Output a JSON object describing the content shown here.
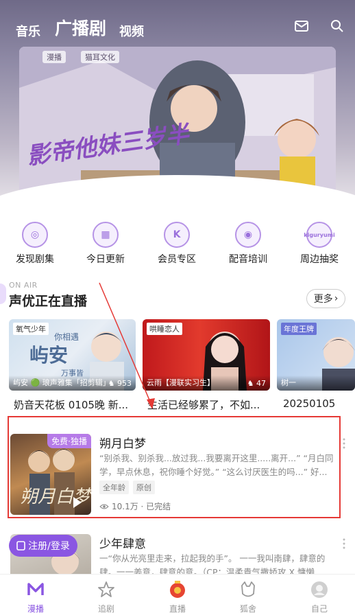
{
  "nav": {
    "tabs": [
      {
        "label": "音乐"
      },
      {
        "label": "广播剧"
      },
      {
        "label": "视频"
      }
    ],
    "icons": [
      "mail-icon",
      "search-icon"
    ]
  },
  "banner": {
    "logos": [
      "漫播",
      "猫耳文化"
    ],
    "title": "影帝他妹三岁半"
  },
  "categories": [
    {
      "label": "发现剧集",
      "icon": "discover-icon"
    },
    {
      "label": "今日更新",
      "icon": "calendar-icon"
    },
    {
      "label": "会员专区",
      "icon": "vip-icon"
    },
    {
      "label": "配音培训",
      "icon": "mic-icon"
    },
    {
      "label": "周边抽奖",
      "icon": "kiguryumi-icon",
      "icon_text": "kiguryumi"
    }
  ],
  "live": {
    "onair": "ON AIR",
    "title": "声优正在直播",
    "more": "更多",
    "cards": [
      {
        "tag": "氧气少年",
        "poster_text": "屿安",
        "poster_sub": "你相遇",
        "poster_sub2": "万事皆",
        "name": "屿安 🟢 琅声雅集「招剪辑」",
        "count": "953",
        "caption": "奶音天花板 0105晚 新..."
      },
      {
        "tag": "哄睡恋人",
        "name": "云雨【漫联实习生】",
        "count": "47",
        "caption": "生活已经够累了，不如..."
      },
      {
        "tag": "年度王牌",
        "name": "树一",
        "count": "",
        "caption": "20250105"
      }
    ]
  },
  "dramas": [
    {
      "badge": "免费·独播",
      "title": "朔月白梦",
      "desc": "“别杀我、别杀我...放过我...我要离开这里.....离开...” “月白同学，早点休息，祝你睡个好觉。” “这么讨厌医生的吗...” 好...",
      "tags": [
        "全年龄",
        "原创"
      ],
      "meta": "10.1万 · 已完结"
    },
    {
      "title": "少年肆意",
      "desc": "一“你从光亮里走来，拉起我的手”。 一一我叫南肆，肆意的肆。一一姜意，肆意的意。（CP：温柔貴气撒娇攻 X 慵懒"
    }
  ],
  "login": {
    "label": "注册/登录"
  },
  "tabbar": [
    {
      "label": "漫播",
      "active": true
    },
    {
      "label": "追剧"
    },
    {
      "label": "直播"
    },
    {
      "label": "狐舍"
    },
    {
      "label": "自己"
    }
  ],
  "colors": {
    "accent": "#8a56e2",
    "highlight": "#e53935",
    "free_badge": "#b67be8"
  }
}
